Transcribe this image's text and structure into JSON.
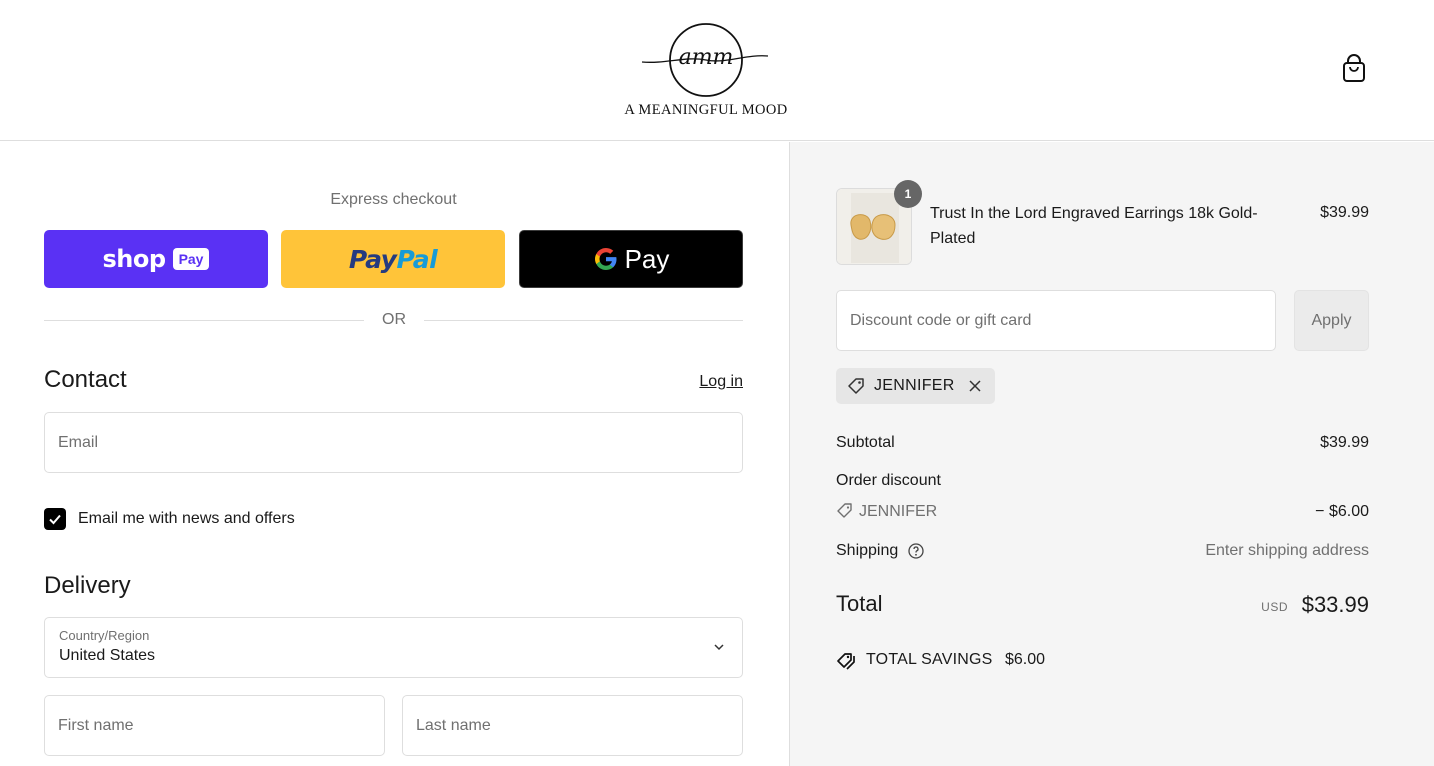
{
  "header": {
    "logo_monogram": "amm",
    "logo_text": "A MEANINGFUL MOOD"
  },
  "express": {
    "title": "Express checkout",
    "shop_label": "shop",
    "shop_badge": "Pay",
    "paypal_part1": "Pay",
    "paypal_part2": "Pal",
    "gpay_label": "Pay",
    "or_label": "OR"
  },
  "contact": {
    "title": "Contact",
    "login_label": "Log in",
    "email_placeholder": "Email",
    "newsletter_label": "Email me with news and offers",
    "newsletter_checked": true
  },
  "delivery": {
    "title": "Delivery",
    "country_label": "Country/Region",
    "country_value": "United States",
    "first_name_placeholder": "First name",
    "last_name_placeholder": "Last name"
  },
  "summary": {
    "product": {
      "quantity": "1",
      "name": "Trust In the Lord Engraved Earrings 18k Gold-Plated",
      "price": "$39.99"
    },
    "discount_placeholder": "Discount code or gift card",
    "apply_label": "Apply",
    "applied_code": "JENNIFER",
    "subtotal_label": "Subtotal",
    "subtotal_value": "$39.99",
    "order_discount_label": "Order discount",
    "order_discount_code": "JENNIFER",
    "order_discount_value": "− $6.00",
    "shipping_label": "Shipping",
    "shipping_value": "Enter shipping address",
    "total_label": "Total",
    "total_currency": "USD",
    "total_value": "$33.99",
    "savings_label": "TOTAL SAVINGS",
    "savings_value": "$6.00"
  },
  "icons": {
    "cart": "shopping-bag-icon",
    "tag": "tag-icon",
    "close": "close-icon",
    "help": "question-circle-icon",
    "chevron": "chevron-down-icon",
    "check": "checkmark-icon",
    "savings": "tags-icon"
  },
  "colors": {
    "shop_pay": "#5a31f4",
    "paypal": "#ffc439",
    "gpay": "#000000",
    "summary_bg": "#f5f5f5"
  }
}
